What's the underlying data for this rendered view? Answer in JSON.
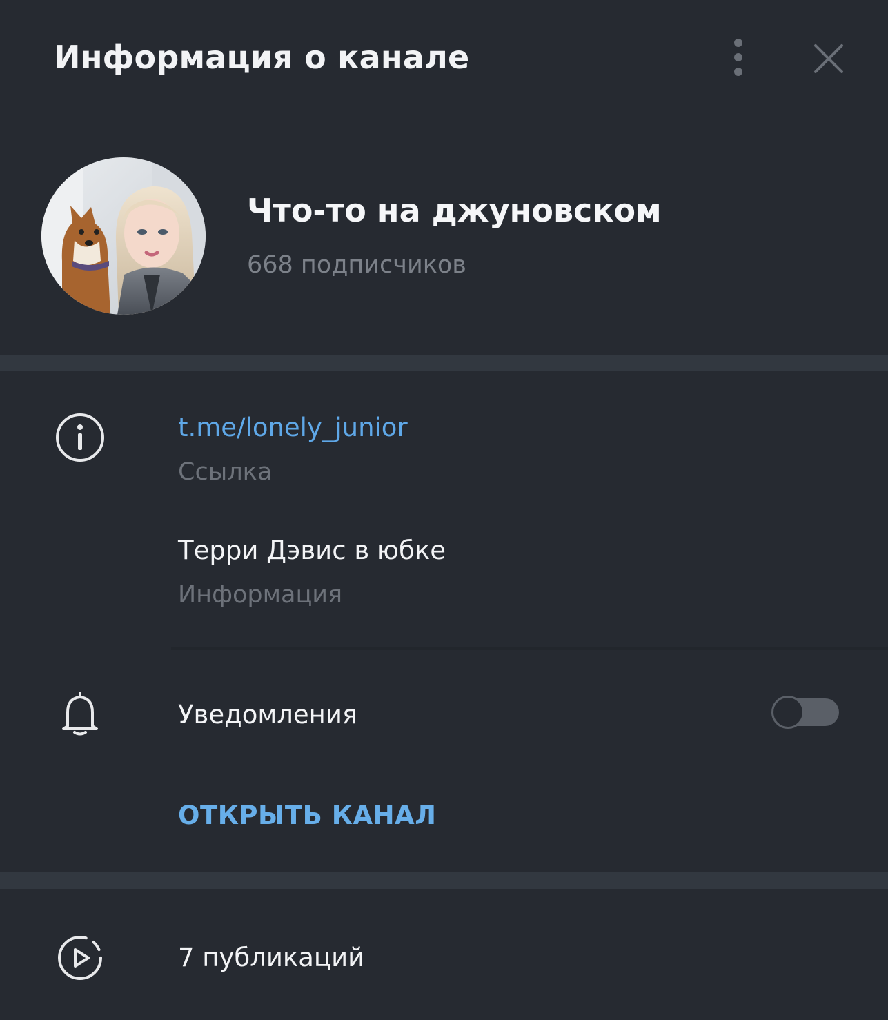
{
  "header": {
    "title": "Информация о канале",
    "more_icon": "more-vertical-icon",
    "close_icon": "close-icon"
  },
  "profile": {
    "avatar_icon": "channel-avatar",
    "name": "Что-то на джуновском",
    "subscribers": "668 подписчиков"
  },
  "info": {
    "link": {
      "icon": "info-icon",
      "value": "t.me/lonely_junior",
      "label": "Ссылка"
    },
    "description": {
      "value": "Терри Дэвис в юбке",
      "label": "Информация"
    }
  },
  "notifications": {
    "icon": "bell-icon",
    "label": "Уведомления",
    "enabled": false
  },
  "actions": {
    "open_channel": "ОТКРЫТЬ КАНАЛ"
  },
  "media": {
    "icon": "stories-icon",
    "posts": "7 публикаций"
  },
  "colors": {
    "background": "#262a31",
    "separator": "#323840",
    "accent": "#5fa8e8",
    "secondary_text": "#6d727a"
  }
}
